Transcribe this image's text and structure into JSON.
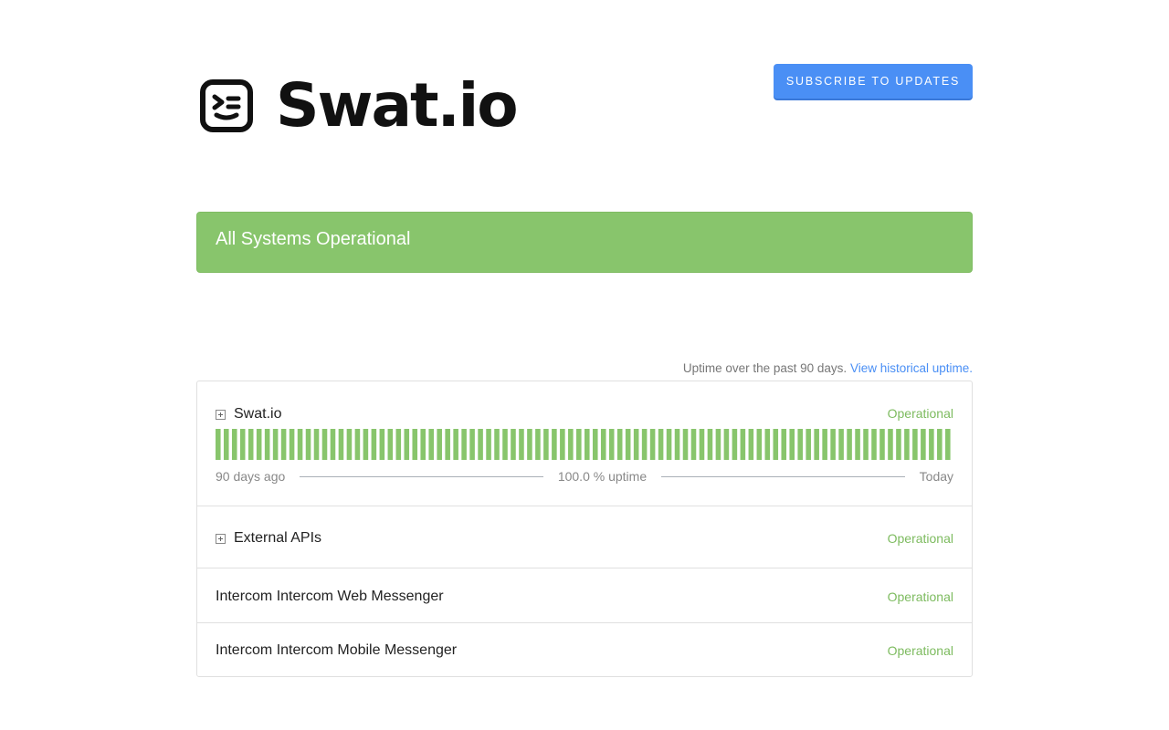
{
  "brand": {
    "name": "Swat.io",
    "logo_icon": "swatio-face-icon"
  },
  "header": {
    "subscribe_label": "SUBSCRIBE TO UPDATES"
  },
  "status_banner": {
    "text": "All Systems Operational",
    "color": "#88c56c"
  },
  "uptime_note": {
    "text": "Uptime over the past 90 days.",
    "link": "View historical uptime."
  },
  "colors": {
    "accent": "#4a8ff5",
    "operational": "#7dbb5f",
    "bar": "#88c56c"
  },
  "components": [
    {
      "name": "Swat.io",
      "status": "Operational",
      "expandable": true,
      "uptime": {
        "days": 90,
        "bar_count": 90,
        "bar_status": "operational",
        "left_label": "90 days ago",
        "center_label": "100.0 % uptime",
        "right_label": "Today"
      }
    },
    {
      "name": "External APIs",
      "status": "Operational",
      "expandable": true
    },
    {
      "name": "Intercom Intercom Web Messenger",
      "status": "Operational",
      "expandable": false
    },
    {
      "name": "Intercom Intercom Mobile Messenger",
      "status": "Operational",
      "expandable": false
    }
  ]
}
